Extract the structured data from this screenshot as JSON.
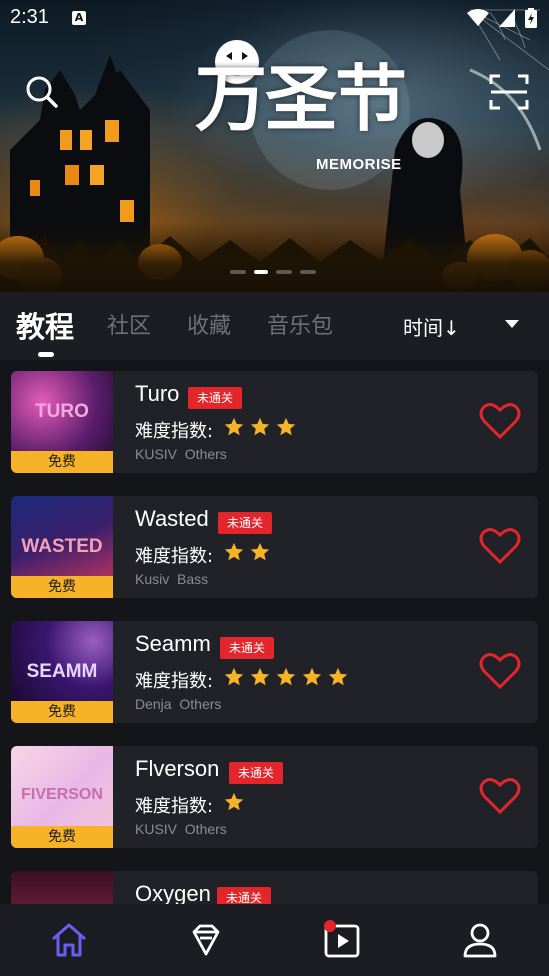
{
  "status_bar": {
    "time": "2:31",
    "notification_glyph": "A"
  },
  "banner": {
    "title": "万圣节",
    "subtitle": "MEMORISE",
    "slides_total": 4,
    "slides_active_index": 1
  },
  "tabs": {
    "items": [
      {
        "label": "教程",
        "active": true
      },
      {
        "label": "社区",
        "active": false
      },
      {
        "label": "收藏",
        "active": false
      },
      {
        "label": "音乐包",
        "active": false
      }
    ],
    "sort_label": "时间↓"
  },
  "songs": [
    {
      "title": "Turo",
      "badge": "未通关",
      "difficulty_label": "难度指数:",
      "stars": 3,
      "artist": "KUSIV",
      "genre": "Others",
      "price_tag": "免费",
      "thumb_text": "TURO",
      "thumb_colors": [
        "#3b1554",
        "#c2479a"
      ]
    },
    {
      "title": "Wasted",
      "badge": "未通关",
      "difficulty_label": "难度指数:",
      "stars": 2,
      "artist": "Kusiv",
      "genre": "Bass",
      "price_tag": "免费",
      "thumb_text": "WASTED",
      "thumb_colors": [
        "#1a1b4a",
        "#e0426a"
      ]
    },
    {
      "title": "Seamm",
      "badge": "未通关",
      "difficulty_label": "难度指数:",
      "stars": 5,
      "artist": "Denja",
      "genre": "Others",
      "price_tag": "免费",
      "thumb_text": "SEAMM",
      "thumb_colors": [
        "#1d0a33",
        "#7a2ab0"
      ]
    },
    {
      "title": "Flverson",
      "badge": "未通关",
      "difficulty_label": "难度指数:",
      "stars": 1,
      "artist": "KUSIV",
      "genre": "Others",
      "price_tag": "免费",
      "thumb_text": "FIVERSON",
      "thumb_colors": [
        "#f3cfe0",
        "#d7a4e8"
      ]
    },
    {
      "title": "Oxygen",
      "badge": "未通关",
      "difficulty_label": "",
      "stars": 0,
      "artist": "",
      "genre": "",
      "price_tag": "",
      "thumb_text": "",
      "thumb_colors": [
        "#2a0d1a",
        "#6b1f3a"
      ]
    }
  ],
  "bottom_nav": {
    "items": [
      {
        "icon": "home-icon",
        "active": true
      },
      {
        "icon": "diamond-icon",
        "active": false
      },
      {
        "icon": "video-play-icon",
        "active": false,
        "notification_dot": true
      },
      {
        "icon": "profile-icon",
        "active": false
      }
    ]
  },
  "colors": {
    "accent": "#6d5cf5",
    "badge_red": "#e3262c",
    "star_gold": "#f6b327",
    "heart_red": "#e3262c",
    "free_tag": "#f6b327"
  }
}
